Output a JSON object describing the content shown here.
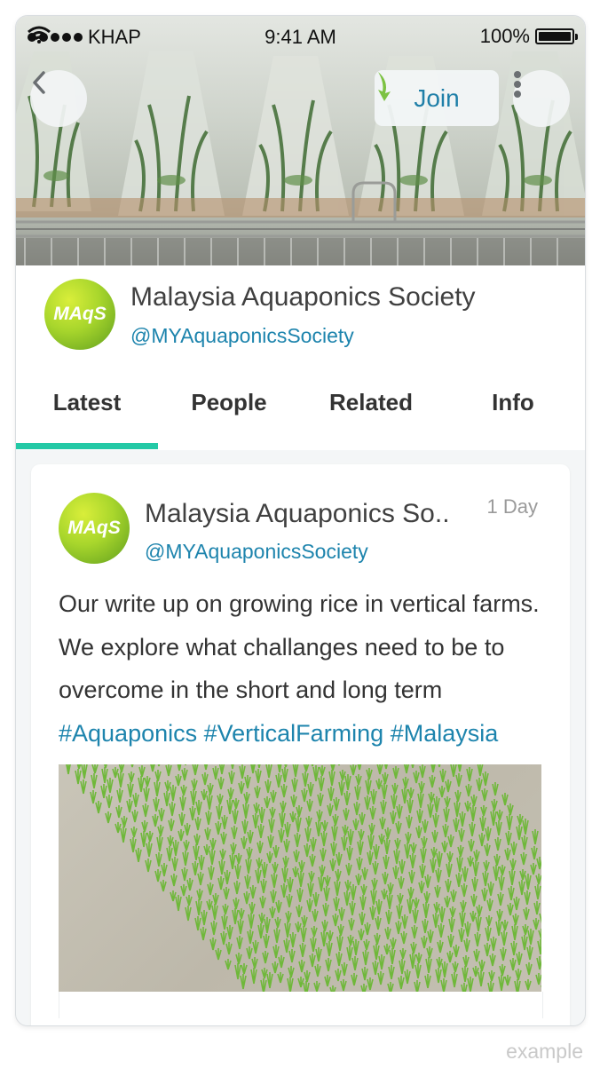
{
  "status_bar": {
    "carrier": "KHAP",
    "time": "9:41 AM",
    "battery": "100%"
  },
  "header": {
    "join_label": "Join"
  },
  "group": {
    "name": "Malaysia Aquaponics Society",
    "handle": "@MYAquaponicsSociety",
    "logo_text": "MAqS"
  },
  "tabs": [
    {
      "label": "Latest",
      "active": true
    },
    {
      "label": "People",
      "active": false
    },
    {
      "label": "Related",
      "active": false
    },
    {
      "label": "Info",
      "active": false
    }
  ],
  "post": {
    "author": "Malaysia Aquaponics So..",
    "handle": "@MYAquaponicsSociety",
    "logo_text": "MAqS",
    "time": "1 Day",
    "body": "Our write up on growing rice in vertical farms. We explore what challanges need to be to overcome in the short and long term",
    "hashtags": "#Aquaponics #VerticalFarming #Malaysia"
  },
  "caption": "example",
  "colors": {
    "accent": "#23c9a6",
    "link": "#1d84ad",
    "join_arrow": "#7cc242"
  },
  "icons": {
    "back": "chevron-left-icon",
    "join": "arrow-join-icon",
    "more": "more-vertical-icon",
    "wifi": "wifi-icon",
    "battery": "battery-icon"
  }
}
